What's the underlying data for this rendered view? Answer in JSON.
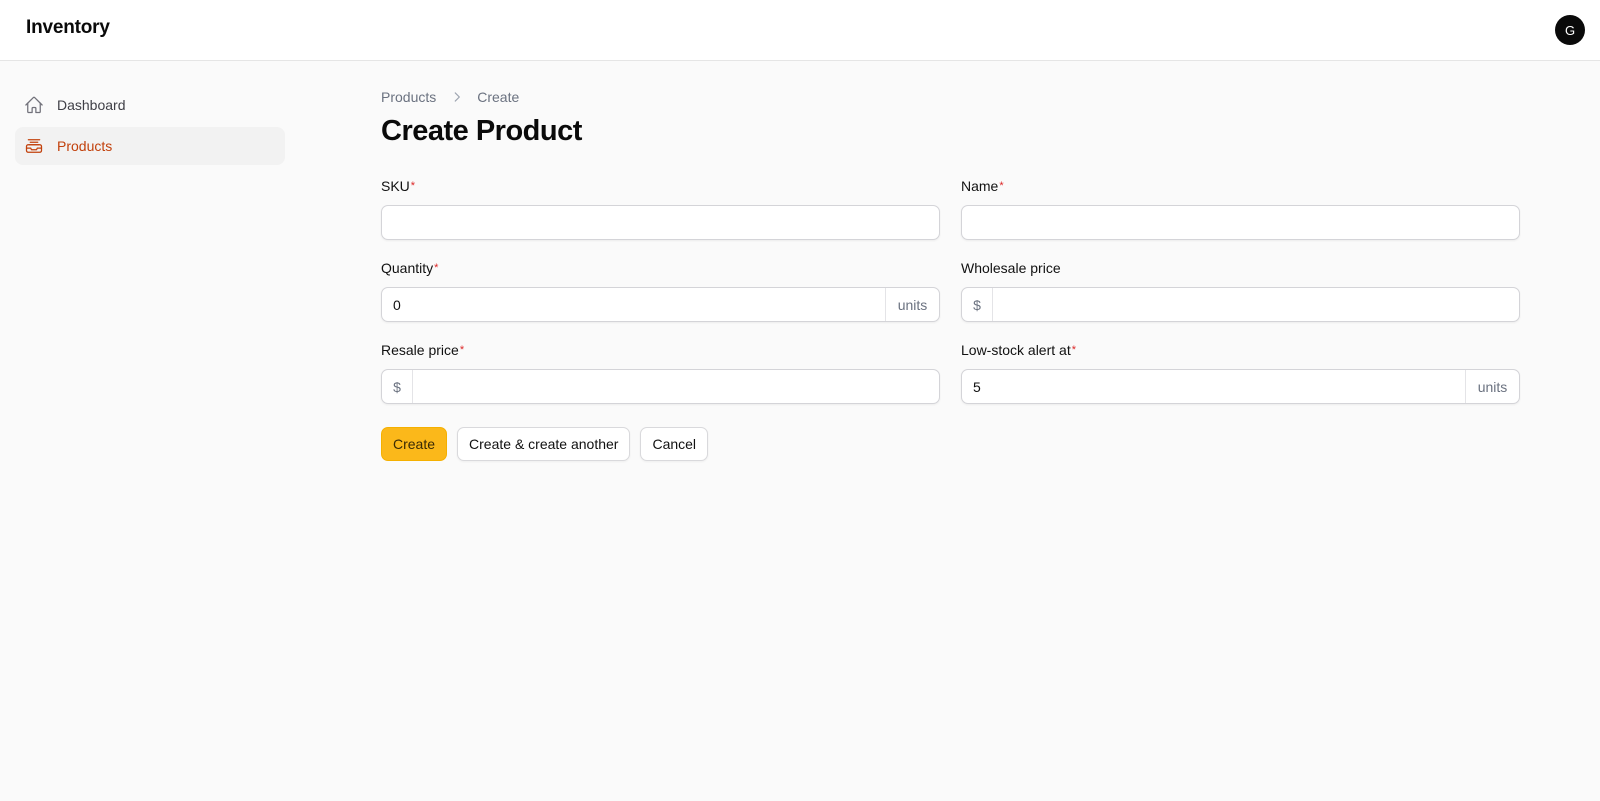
{
  "app": {
    "title": "Inventory",
    "user_initial": "G"
  },
  "sidebar": {
    "items": [
      {
        "label": "Dashboard",
        "icon": "home-icon",
        "active": false
      },
      {
        "label": "Products",
        "icon": "inbox-stack-icon",
        "active": true
      }
    ]
  },
  "breadcrumb": {
    "items": [
      "Products",
      "Create"
    ]
  },
  "page": {
    "title": "Create Product"
  },
  "form": {
    "required_marker": "*",
    "sku": {
      "label": "SKU",
      "value": ""
    },
    "name": {
      "label": "Name",
      "value": ""
    },
    "quantity": {
      "label": "Quantity",
      "value": "0",
      "suffix": "units"
    },
    "wholesale_price": {
      "label": "Wholesale price",
      "value": "",
      "prefix": "$"
    },
    "resale_price": {
      "label": "Resale price",
      "value": "",
      "prefix": "$"
    },
    "low_stock_alert": {
      "label": "Low-stock alert at",
      "value": "5",
      "suffix": "units"
    }
  },
  "actions": {
    "create": "Create",
    "create_another": "Create & create another",
    "cancel": "Cancel"
  },
  "colors": {
    "accent": "#fbb81a",
    "active_nav": "#c2410c",
    "required": "#dc2626"
  }
}
